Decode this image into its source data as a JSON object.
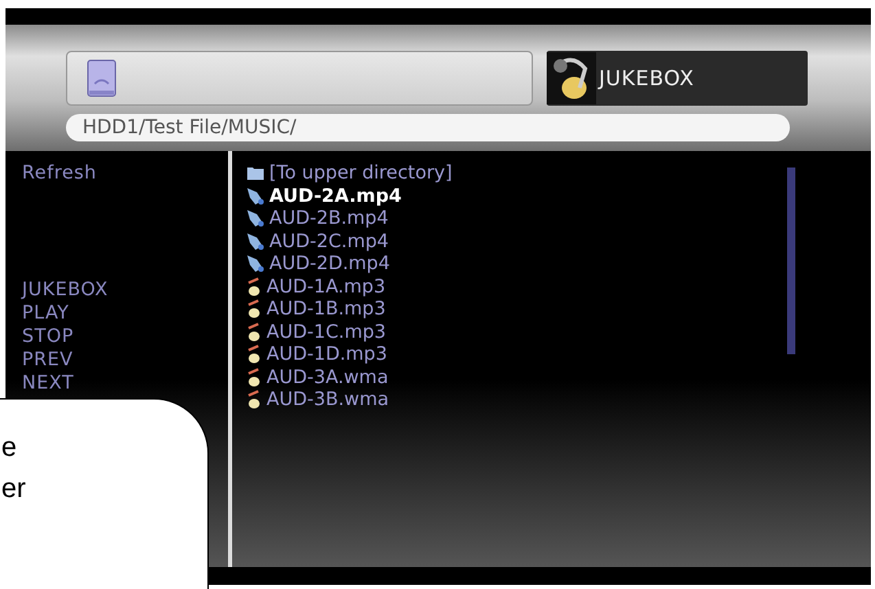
{
  "header": {
    "mode_label": "JUKEBOX",
    "path": "HDD1/Test File/MUSIC/"
  },
  "menu_top": [
    "Refresh"
  ],
  "menu": [
    "JUKEBOX",
    "PLAY",
    "STOP",
    "PREV",
    "NEXT"
  ],
  "files": [
    {
      "name": "[To upper directory]",
      "kind": "folder",
      "selected": false
    },
    {
      "name": "AUD-2A.mp4",
      "kind": "video",
      "selected": true
    },
    {
      "name": "AUD-2B.mp4",
      "kind": "video",
      "selected": false
    },
    {
      "name": "AUD-2C.mp4",
      "kind": "video",
      "selected": false
    },
    {
      "name": "AUD-2D.mp4",
      "kind": "video",
      "selected": false
    },
    {
      "name": "AUD-1A.mp3",
      "kind": "audio",
      "selected": false
    },
    {
      "name": "AUD-1B.mp3",
      "kind": "audio",
      "selected": false
    },
    {
      "name": "AUD-1C.mp3",
      "kind": "audio",
      "selected": false
    },
    {
      "name": "AUD-1D.mp3",
      "kind": "audio",
      "selected": false
    },
    {
      "name": "AUD-3A.wma",
      "kind": "audio",
      "selected": false
    },
    {
      "name": "AUD-3B.wma",
      "kind": "audio",
      "selected": false
    }
  ],
  "callout": {
    "lines": [
      "e",
      "er"
    ]
  }
}
